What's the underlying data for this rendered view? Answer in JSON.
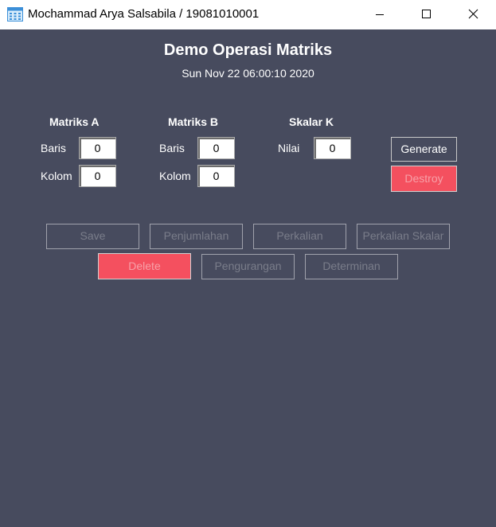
{
  "window": {
    "title": "Mochammad Arya Salsabila / 19081010001",
    "icon": "app-window-icon",
    "controls": [
      "minimize-icon",
      "maximize-icon",
      "close-icon"
    ]
  },
  "header": {
    "title": "Demo Operasi Matriks",
    "datetime": "Sun Nov 22 06:00:10 2020"
  },
  "matriks_a": {
    "heading": "Matriks A",
    "baris_label": "Baris",
    "baris_value": "0",
    "kolom_label": "Kolom",
    "kolom_value": "0"
  },
  "matriks_b": {
    "heading": "Matriks B",
    "baris_label": "Baris",
    "baris_value": "0",
    "kolom_label": "Kolom",
    "kolom_value": "0"
  },
  "skalar_k": {
    "heading": "Skalar K",
    "nilai_label": "Nilai",
    "nilai_value": "0"
  },
  "actions": {
    "generate": "Generate",
    "destroy": "Destroy"
  },
  "operations": {
    "save": "Save",
    "penjumlahan": "Penjumlahan",
    "perkalian": "Perkalian",
    "perkalian_skalar": "Perkalian Skalar",
    "delete": "Delete",
    "pengurangan": "Pengurangan",
    "determinan": "Determinan"
  },
  "colors": {
    "background": "#474b5e",
    "danger": "#f4505f",
    "text": "#ffffff",
    "disabled_text": "#7a7d8a"
  }
}
